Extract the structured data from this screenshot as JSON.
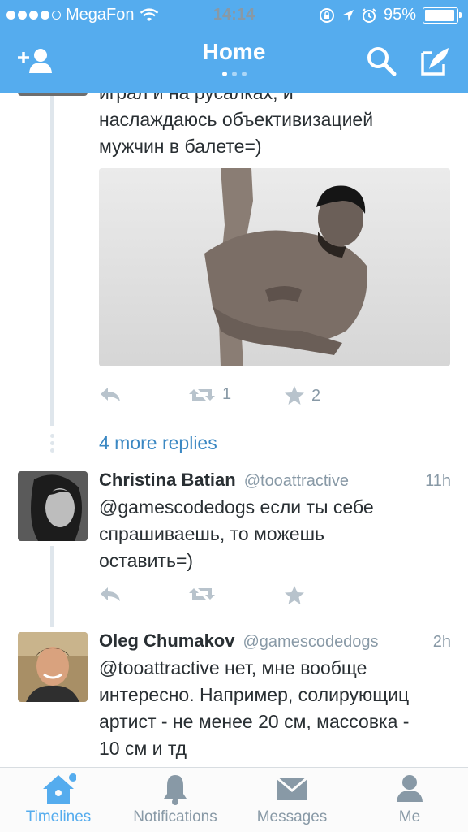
{
  "status_bar": {
    "carrier": "MegaFon",
    "time": "14:14",
    "battery_percent": "95%",
    "battery_level": 0.95,
    "signal_dots_filled": 4,
    "signal_dots_total": 5
  },
  "header": {
    "title": "Home",
    "pager_count": 3,
    "pager_active": 0,
    "color": "#55acee"
  },
  "thread": {
    "first_tweet": {
      "text_partial": "играл и на русалках, и",
      "text_line2": "наслаждаюсь объективизацией",
      "text_line3": "мужчин в балете=)",
      "retweets": "1",
      "favorites": "2"
    },
    "more_replies": "4 more replies",
    "replies": [
      {
        "name": "Christina Batian",
        "handle": "@tooattractive",
        "time": "11h",
        "text_line1": "@gamescodedogs если ты себе",
        "text_line2": "спрашиваешь, то можешь",
        "text_line3": "оставить=)"
      },
      {
        "name": "Oleg Chumakov",
        "handle": "@gamescodedogs",
        "time": "2h",
        "text_line1": "@tooattractive нет, мне вообще",
        "text_line2": "интересно. Например, солирующиц",
        "text_line3": "артист - не менее 20 см, массовка -",
        "text_line4": "10 см и тд"
      }
    ]
  },
  "tabbar": {
    "tabs": [
      {
        "label": "Timelines",
        "icon": "home-icon",
        "active": true
      },
      {
        "label": "Notifications",
        "icon": "bell-icon",
        "active": false
      },
      {
        "label": "Messages",
        "icon": "envelope-icon",
        "active": false
      },
      {
        "label": "Me",
        "icon": "person-icon",
        "active": false
      }
    ],
    "active_color": "#55acee",
    "inactive_color": "#8899a6"
  }
}
